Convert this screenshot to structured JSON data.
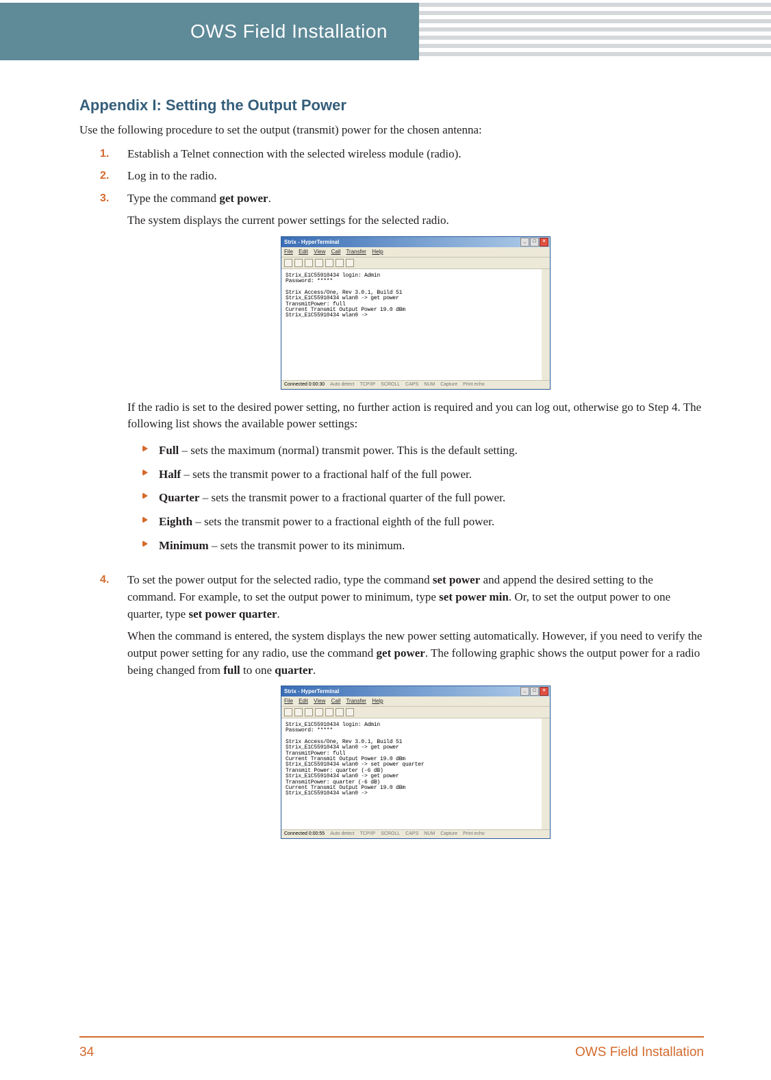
{
  "banner": {
    "title": "OWS Field Installation"
  },
  "heading": "Appendix I: Setting the Output Power",
  "intro": "Use the following procedure to set the output (transmit) power for the chosen antenna:",
  "steps": {
    "s1": {
      "num": "1.",
      "text_a": "Establish a Telnet connection with the selected wireless module (radio)."
    },
    "s2": {
      "num": "2.",
      "text_a": "Log in to the radio."
    },
    "s3": {
      "num": "3.",
      "text_a": "Type the command ",
      "bold_a": "get power",
      "text_b": ".",
      "extra_a": "The system displays the current power settings for the selected radio.",
      "after_fig": "If the radio is set to the desired power setting, no further action is required and you can log out, otherwise go to Step 4. The following list shows the available power settings:"
    },
    "s4": {
      "num": "4.",
      "text_a": "To set the power output for the selected radio, type the command ",
      "bold_a": "set power",
      "text_b": " and append the desired setting to the command. For example, to set the output power to minimum, type ",
      "bold_b": "set power min",
      "text_c": ". Or, to set the output power to one quarter, type ",
      "bold_c": "set power quarter",
      "text_d": ".",
      "para2_a": "When the command is entered, the system displays the new power setting automatically. However, if you need to verify the output power setting for any radio, use the command ",
      "para2_bold": "get power",
      "para2_b": ". The following graphic shows the output power for a radio being changed from ",
      "para2_bold2": "full",
      "para2_c": " to one ",
      "para2_bold3": "quarter",
      "para2_d": "."
    }
  },
  "bullets": {
    "b1": {
      "term": "Full",
      "desc": " – sets the maximum (normal) transmit power. This is the default setting."
    },
    "b2": {
      "term": "Half",
      "desc": " – sets the transmit power to a fractional half of the full power."
    },
    "b3": {
      "term": "Quarter",
      "desc": " – sets the transmit power to a fractional quarter of the full power."
    },
    "b4": {
      "term": "Eighth",
      "desc": " – sets the transmit power to a fractional eighth of the full power."
    },
    "b5": {
      "term": "Minimum",
      "desc": " – sets the transmit power to its minimum."
    }
  },
  "hyperterm": {
    "title": "Strix - HyperTerminal",
    "menu": {
      "file": "File",
      "edit": "Edit",
      "view": "View",
      "call": "Call",
      "transfer": "Transfer",
      "help": "Help"
    },
    "status": {
      "conn1": "Connected 0:00:30",
      "conn2": "Connected 0:00:55",
      "auto": "Auto detect",
      "proto": "TCP/IP",
      "scroll": "SCROLL",
      "caps": "CAPS",
      "num": "NUM",
      "capture": "Capture",
      "echo": "Print echo"
    },
    "body1": "Strix_E1C55910434 login: Admin\nPassword: *****\n\nStrix Access/One, Rev 3.0.1, Build 51\nStrix_E1C55910434 wlan0 -> get power\nTransmitPower: full\nCurrent Transmit Output Power 19.0 dBm\nStrix_E1C55910434 wlan0 ->",
    "body2": "Strix_E1C55910434 login: Admin\nPassword: *****\n\nStrix Access/One, Rev 3.0.1, Build 51\nStrix_E1C55910434 wlan0 -> get power\nTransmitPower: full\nCurrent Transmit Output Power 19.0 dBm\nStrix_E1C55910434 wlan0 -> set power quarter\nTransmit Power: quarter (-6 dB)\nStrix_E1C55910434 wlan0 -> get power\nTransmitPower: quarter (-6 dB)\nCurrent Transmit Output Power 19.0 dBm\nStrix_E1C55910434 wlan0 ->"
  },
  "footer": {
    "page": "34",
    "label": "OWS Field Installation"
  }
}
